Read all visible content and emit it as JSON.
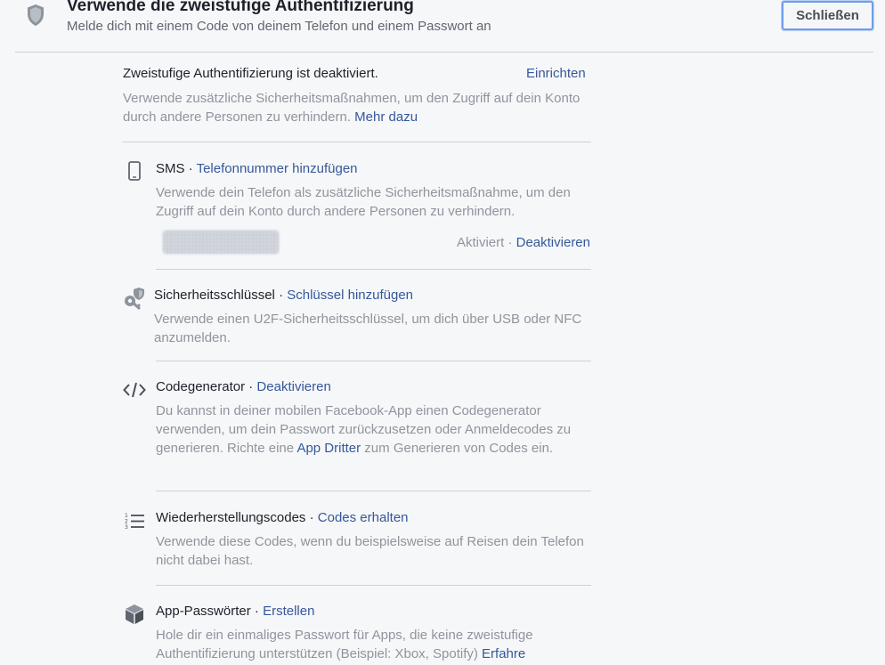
{
  "header": {
    "title": "Verwende die zweistufige Authentifizierung",
    "subtitle": "Melde dich mit einem Code von deinem Telefon und einem Passwort an",
    "close_label": "Schließen"
  },
  "intro": {
    "status": "Zweistufige Authentifizierung ist deaktiviert.",
    "setup_link": "Einrichten",
    "description": "Verwende zusätzliche Sicherheitsmaßnahmen, um den Zugriff auf dein Konto durch andere Personen zu verhindern.",
    "more_link": "Mehr dazu"
  },
  "sms": {
    "title": "SMS",
    "separator": " · ",
    "action": "Telefonnummer hinzufügen",
    "description": "Verwende dein Telefon als zusätzliche Sicherheitsmaßnahme, um den Zugriff auf dein Konto durch andere Personen zu verhindern.",
    "state": "Aktiviert",
    "state_separator": " · ",
    "state_action": "Deaktivieren",
    "icon": "phone-icon"
  },
  "security_key": {
    "title": "Sicherheitsschlüssel",
    "separator": " · ",
    "action": "Schlüssel hinzufügen",
    "description": "Verwende einen U2F-Sicherheitsschlüssel, um dich über USB oder NFC anzumelden.",
    "icon": "key-icon"
  },
  "code_generator": {
    "title": "Codegenerator",
    "separator": " · ",
    "action": "Deaktivieren",
    "description_before": "Du kannst in deiner mobilen Facebook-App einen Codegenerator verwenden, um dein Passwort zurückzusetzen oder Anmeldecodes zu generieren. Richte eine ",
    "description_link": "App Dritter",
    "description_after": " zum Generieren von Codes ein.",
    "icon": "code-icon"
  },
  "recovery_codes": {
    "title": "Wiederherstellungscodes",
    "separator": " · ",
    "action": "Codes erhalten",
    "description": "Verwende diese Codes, wenn du beispielsweise auf Reisen dein Telefon nicht dabei hast.",
    "icon": "numbered-list-icon"
  },
  "app_passwords": {
    "title": "App-Passwörter",
    "separator": " · ",
    "action": "Erstellen",
    "description": "Hole dir ein einmaliges Passwort für Apps, die keine zweistufige Authentifizierung unterstützen (Beispiel: Xbox, Spotify)",
    "description_link": "Erfahre",
    "icon": "cube-icon"
  },
  "colors": {
    "link": "#365899",
    "muted_text": "#90949c",
    "primary_text": "#1d2129",
    "divider": "#cfd1d5",
    "background": "#f6f7f9"
  }
}
